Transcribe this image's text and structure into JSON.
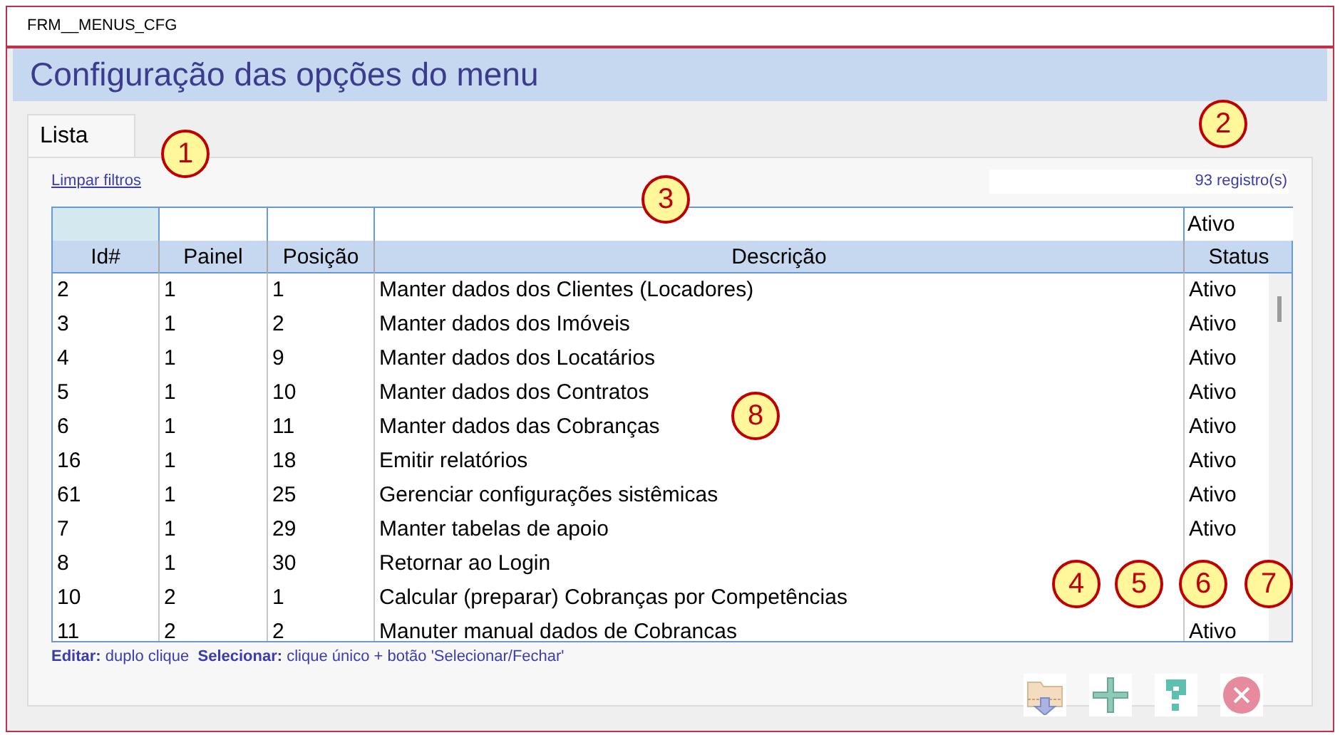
{
  "window": {
    "title": "FRM__MENUS_CFG"
  },
  "header": {
    "title": "Configuração das opções do menu"
  },
  "tabs": [
    {
      "label": "Lista",
      "selected": true
    }
  ],
  "clear_filters_link": "Limpar filtros",
  "record_count": "93 registro(s)",
  "table": {
    "columns": [
      {
        "label": "Id#",
        "filter_selected": true
      },
      {
        "label": "Painel",
        "filter_selected": false
      },
      {
        "label": "Posição",
        "filter_selected": false
      },
      {
        "label": "Descrição",
        "filter_selected": false
      },
      {
        "label": "Status",
        "filter_selected": false,
        "filter": "Ativo"
      }
    ],
    "rows": [
      [
        "2",
        "1",
        "1",
        "Manter dados dos Clientes (Locadores)",
        "Ativo"
      ],
      [
        "3",
        "1",
        "2",
        "Manter dados dos Imóveis",
        "Ativo"
      ],
      [
        "4",
        "1",
        "9",
        "Manter dados dos Locatários",
        "Ativo"
      ],
      [
        "5",
        "1",
        "10",
        "Manter dados dos Contratos",
        "Ativo"
      ],
      [
        "6",
        "1",
        "11",
        "Manter dados das Cobranças",
        "Ativo"
      ],
      [
        "16",
        "1",
        "18",
        "Emitir relatórios",
        "Ativo"
      ],
      [
        "61",
        "1",
        "25",
        "Gerenciar configurações sistêmicas",
        "Ativo"
      ],
      [
        "7",
        "1",
        "29",
        "Manter tabelas de apoio",
        "Ativo"
      ],
      [
        "8",
        "1",
        "30",
        "Retornar ao Login"
      ],
      [
        "10",
        "2",
        "1",
        "Calcular (preparar) Cobranças por Competências"
      ],
      [
        "11",
        "2",
        "2",
        "Manuter manual dados de Cobrancas",
        "Ativo"
      ]
    ]
  },
  "hint": "**Editar:** duplo clique  **Selecionar:** clique único + botão 'Selecionar/Fechar'",
  "buttons": [
    {
      "kind": "select"
    },
    {
      "kind": "add"
    },
    {
      "kind": "help"
    },
    {
      "kind": "close"
    }
  ],
  "callouts": [
    "1",
    "2",
    "3",
    "4",
    "5",
    "6",
    "7",
    "8"
  ]
}
